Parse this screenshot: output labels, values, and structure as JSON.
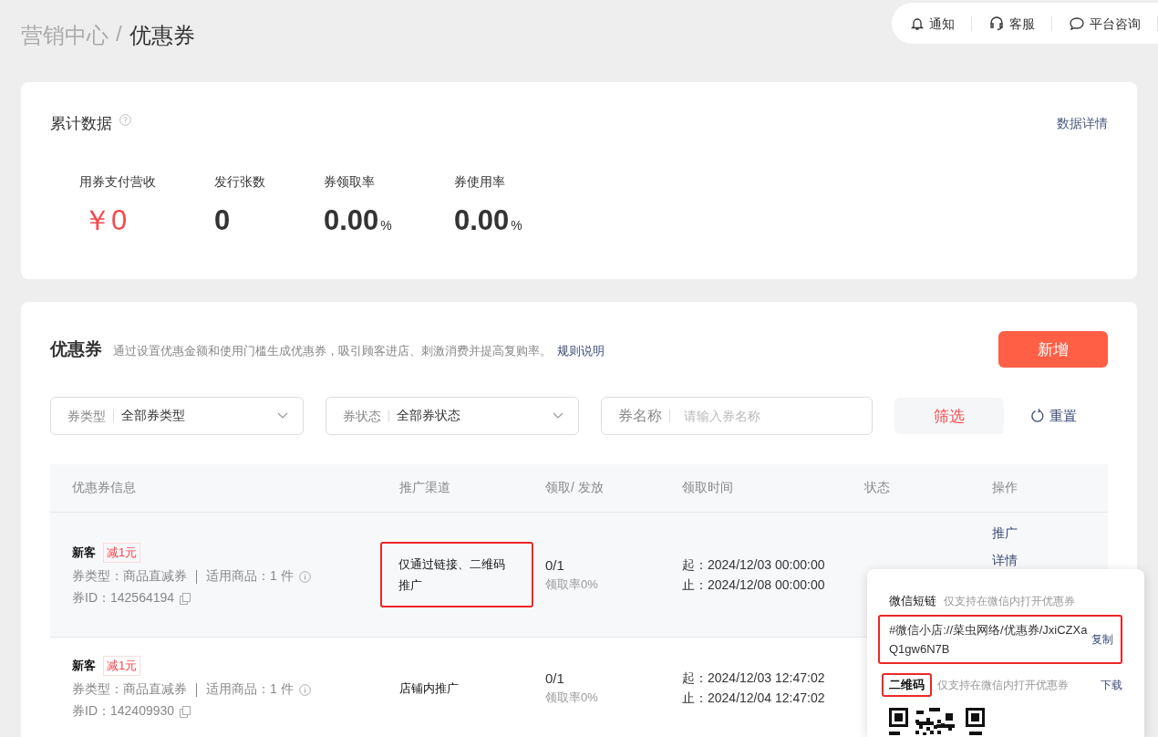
{
  "breadcrumb": {
    "parent": "营销中心",
    "separator": "/",
    "current": "优惠券"
  },
  "top_actions": [
    {
      "label": "通知"
    },
    {
      "label": "客服"
    },
    {
      "label": "平台咨询"
    }
  ],
  "summary": {
    "title": "累计数据",
    "link": "数据详情",
    "metrics": [
      {
        "kind": "money",
        "label": "用券支付营收",
        "prefix": "￥",
        "value": "0"
      },
      {
        "kind": "count",
        "label": "发行张数",
        "value": "0"
      },
      {
        "kind": "rate",
        "label": "券领取率",
        "value": "0.00",
        "unit": "%"
      },
      {
        "kind": "rate",
        "label": "券使用率",
        "value": "0.00",
        "unit": "%"
      }
    ]
  },
  "coupons": {
    "title": "优惠券",
    "description": "通过设置优惠金额和使用门槛生成优惠券，吸引顾客进店、刺激消费并提高复购率。",
    "rule_link": "规则说明",
    "add_button": "新增",
    "filters": [
      {
        "kind": "select",
        "label": "券类型",
        "value": "全部券类型"
      },
      {
        "kind": "select",
        "label": "券状态",
        "value": "全部券状态"
      },
      {
        "kind": "text",
        "label": "券名称",
        "placeholder": "请输入券名称"
      }
    ],
    "filter_button": "筛选",
    "reset_button": "重置",
    "table": {
      "columns": [
        "优惠券信息",
        "推广渠道",
        "领取/ 发放",
        "领取时间",
        "状态",
        "操作"
      ],
      "rows": [
        {
          "hovered": true,
          "name": "新客",
          "tag": "减1元",
          "type_line": "券类型：商品直减券",
          "goods_line": "适用商品：1 件",
          "id_line": "券ID：142564194",
          "channel": "仅通过链接、二维码推广",
          "channel_annotated": true,
          "claimed": "0/1",
          "claim_rate": "领取率0%",
          "start": "起：2024/12/03 00:00:00",
          "end": "止：2024/12/08 00:00:00",
          "actions": [
            "推广",
            "详情"
          ]
        },
        {
          "hovered": false,
          "name": "新客",
          "tag": "减1元",
          "type_line": "券类型：商品直减券",
          "goods_line": "适用商品：1 件",
          "id_line": "券ID：142409930",
          "channel": "店铺内推广",
          "channel_annotated": false,
          "claimed": "0/1",
          "claim_rate": "领取率0%",
          "start": "起：2024/12/03 12:47:02",
          "end": "止：2024/12/04 12:47:02"
        }
      ]
    }
  },
  "popover": {
    "short_link": {
      "title": "微信短链",
      "hint": "仅支持在微信内打开优惠券",
      "value": "#微信小店://菜虫网络/优惠券/JxiCZXaQ1gw6N7B",
      "annotated": true,
      "action": "复制"
    },
    "qr": {
      "title": "二维码",
      "hint": "仅支持在微信内打开优惠券",
      "annotated": true,
      "action": "下载"
    }
  }
}
